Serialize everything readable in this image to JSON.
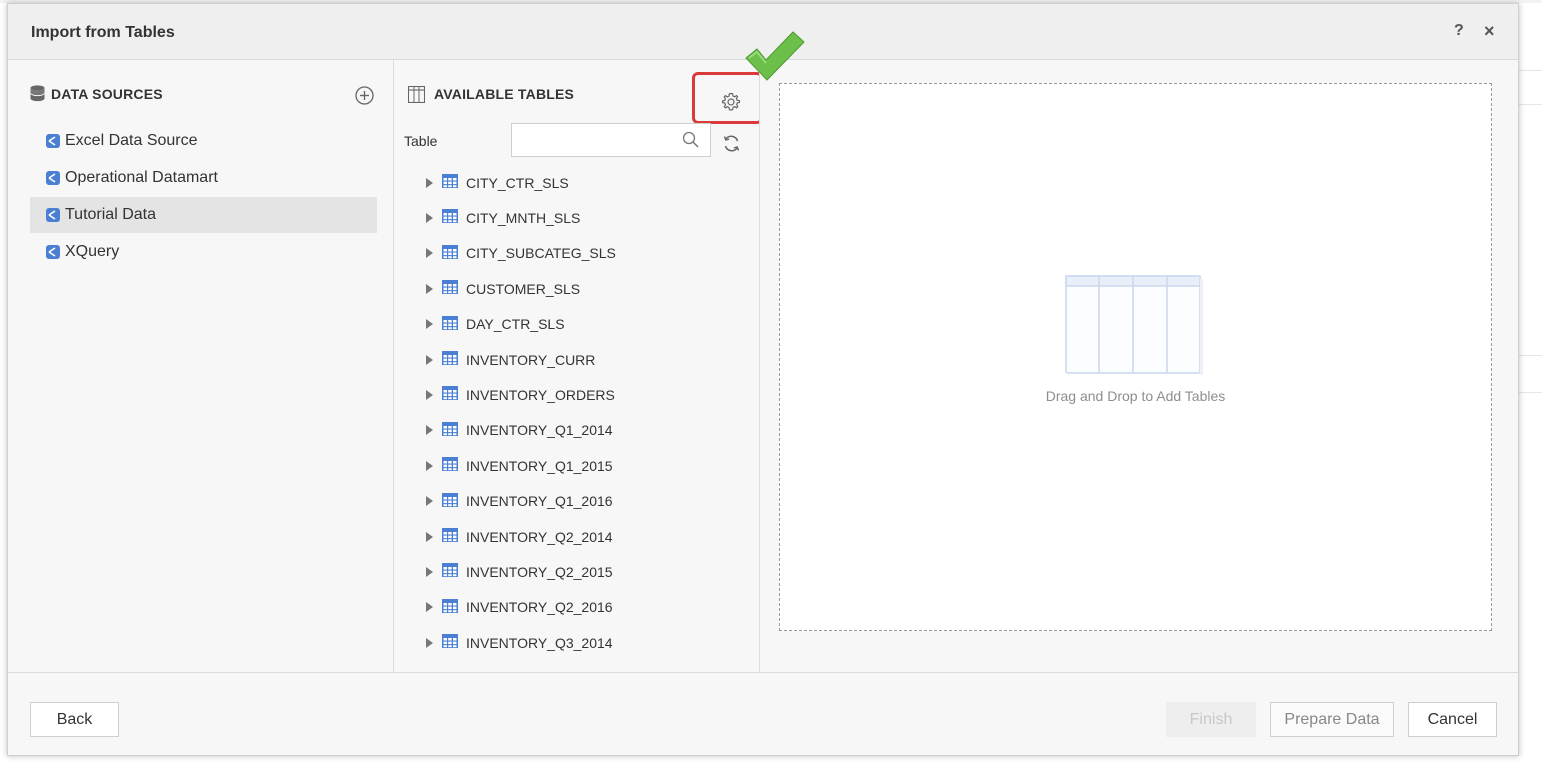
{
  "dialog": {
    "title": "Import from Tables",
    "help_label": "?",
    "close_label": "×"
  },
  "data_sources": {
    "heading": "DATA SOURCES",
    "items": [
      {
        "label": "Excel Data Source",
        "selected": false
      },
      {
        "label": "Operational Datamart",
        "selected": false
      },
      {
        "label": "Tutorial Data",
        "selected": true
      },
      {
        "label": "XQuery",
        "selected": false
      }
    ]
  },
  "available_tables": {
    "heading": "AVAILABLE TABLES",
    "search_label": "Table",
    "search_value": "",
    "tables": [
      "CITY_CTR_SLS",
      "CITY_MNTH_SLS",
      "CITY_SUBCATEG_SLS",
      "CUSTOMER_SLS",
      "DAY_CTR_SLS",
      "INVENTORY_CURR",
      "INVENTORY_ORDERS",
      "INVENTORY_Q1_2014",
      "INVENTORY_Q1_2015",
      "INVENTORY_Q1_2016",
      "INVENTORY_Q2_2014",
      "INVENTORY_Q2_2015",
      "INVENTORY_Q2_2016",
      "INVENTORY_Q3_2014"
    ]
  },
  "drop_zone": {
    "text": "Drag and Drop to Add Tables"
  },
  "footer": {
    "back_label": "Back",
    "finish_label": "Finish",
    "prepare_label": "Prepare Data",
    "cancel_label": "Cancel"
  },
  "colors": {
    "highlight": "#d93a3a",
    "checkmark": "#6cc04a",
    "table_icon": "#4a7fd4"
  },
  "icons": {
    "data_sources": "database-icon",
    "add_source": "plus-circle-icon",
    "available_tables": "table-grid-icon",
    "settings": "gear-icon",
    "search": "search-icon",
    "refresh": "refresh-icon",
    "source_item": "datasource-icon",
    "table_item": "table-icon"
  }
}
